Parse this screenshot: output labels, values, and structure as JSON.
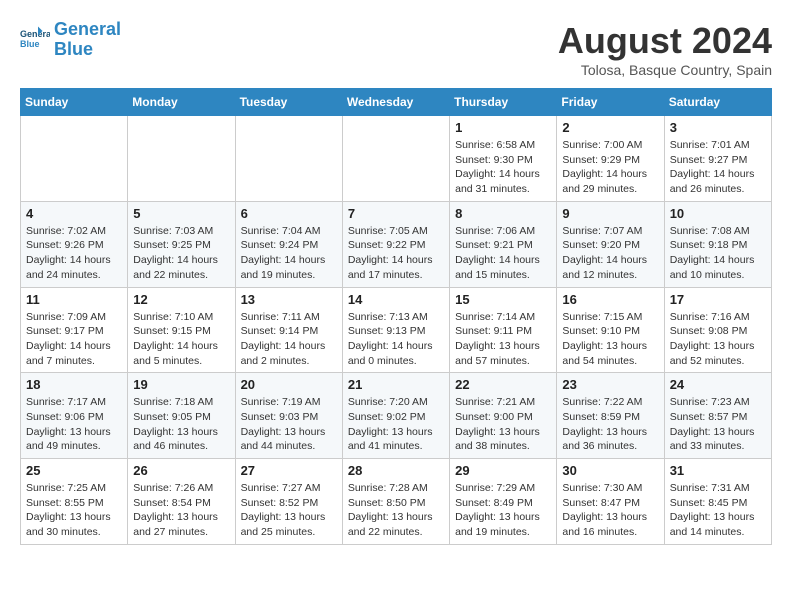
{
  "header": {
    "logo_line1": "General",
    "logo_line2": "Blue",
    "title": "August 2024",
    "subtitle": "Tolosa, Basque Country, Spain"
  },
  "weekdays": [
    "Sunday",
    "Monday",
    "Tuesday",
    "Wednesday",
    "Thursday",
    "Friday",
    "Saturday"
  ],
  "weeks": [
    [
      {
        "day": "",
        "info": ""
      },
      {
        "day": "",
        "info": ""
      },
      {
        "day": "",
        "info": ""
      },
      {
        "day": "",
        "info": ""
      },
      {
        "day": "1",
        "info": "Sunrise: 6:58 AM\nSunset: 9:30 PM\nDaylight: 14 hours\nand 31 minutes."
      },
      {
        "day": "2",
        "info": "Sunrise: 7:00 AM\nSunset: 9:29 PM\nDaylight: 14 hours\nand 29 minutes."
      },
      {
        "day": "3",
        "info": "Sunrise: 7:01 AM\nSunset: 9:27 PM\nDaylight: 14 hours\nand 26 minutes."
      }
    ],
    [
      {
        "day": "4",
        "info": "Sunrise: 7:02 AM\nSunset: 9:26 PM\nDaylight: 14 hours\nand 24 minutes."
      },
      {
        "day": "5",
        "info": "Sunrise: 7:03 AM\nSunset: 9:25 PM\nDaylight: 14 hours\nand 22 minutes."
      },
      {
        "day": "6",
        "info": "Sunrise: 7:04 AM\nSunset: 9:24 PM\nDaylight: 14 hours\nand 19 minutes."
      },
      {
        "day": "7",
        "info": "Sunrise: 7:05 AM\nSunset: 9:22 PM\nDaylight: 14 hours\nand 17 minutes."
      },
      {
        "day": "8",
        "info": "Sunrise: 7:06 AM\nSunset: 9:21 PM\nDaylight: 14 hours\nand 15 minutes."
      },
      {
        "day": "9",
        "info": "Sunrise: 7:07 AM\nSunset: 9:20 PM\nDaylight: 14 hours\nand 12 minutes."
      },
      {
        "day": "10",
        "info": "Sunrise: 7:08 AM\nSunset: 9:18 PM\nDaylight: 14 hours\nand 10 minutes."
      }
    ],
    [
      {
        "day": "11",
        "info": "Sunrise: 7:09 AM\nSunset: 9:17 PM\nDaylight: 14 hours\nand 7 minutes."
      },
      {
        "day": "12",
        "info": "Sunrise: 7:10 AM\nSunset: 9:15 PM\nDaylight: 14 hours\nand 5 minutes."
      },
      {
        "day": "13",
        "info": "Sunrise: 7:11 AM\nSunset: 9:14 PM\nDaylight: 14 hours\nand 2 minutes."
      },
      {
        "day": "14",
        "info": "Sunrise: 7:13 AM\nSunset: 9:13 PM\nDaylight: 14 hours\nand 0 minutes."
      },
      {
        "day": "15",
        "info": "Sunrise: 7:14 AM\nSunset: 9:11 PM\nDaylight: 13 hours\nand 57 minutes."
      },
      {
        "day": "16",
        "info": "Sunrise: 7:15 AM\nSunset: 9:10 PM\nDaylight: 13 hours\nand 54 minutes."
      },
      {
        "day": "17",
        "info": "Sunrise: 7:16 AM\nSunset: 9:08 PM\nDaylight: 13 hours\nand 52 minutes."
      }
    ],
    [
      {
        "day": "18",
        "info": "Sunrise: 7:17 AM\nSunset: 9:06 PM\nDaylight: 13 hours\nand 49 minutes."
      },
      {
        "day": "19",
        "info": "Sunrise: 7:18 AM\nSunset: 9:05 PM\nDaylight: 13 hours\nand 46 minutes."
      },
      {
        "day": "20",
        "info": "Sunrise: 7:19 AM\nSunset: 9:03 PM\nDaylight: 13 hours\nand 44 minutes."
      },
      {
        "day": "21",
        "info": "Sunrise: 7:20 AM\nSunset: 9:02 PM\nDaylight: 13 hours\nand 41 minutes."
      },
      {
        "day": "22",
        "info": "Sunrise: 7:21 AM\nSunset: 9:00 PM\nDaylight: 13 hours\nand 38 minutes."
      },
      {
        "day": "23",
        "info": "Sunrise: 7:22 AM\nSunset: 8:59 PM\nDaylight: 13 hours\nand 36 minutes."
      },
      {
        "day": "24",
        "info": "Sunrise: 7:23 AM\nSunset: 8:57 PM\nDaylight: 13 hours\nand 33 minutes."
      }
    ],
    [
      {
        "day": "25",
        "info": "Sunrise: 7:25 AM\nSunset: 8:55 PM\nDaylight: 13 hours\nand 30 minutes."
      },
      {
        "day": "26",
        "info": "Sunrise: 7:26 AM\nSunset: 8:54 PM\nDaylight: 13 hours\nand 27 minutes."
      },
      {
        "day": "27",
        "info": "Sunrise: 7:27 AM\nSunset: 8:52 PM\nDaylight: 13 hours\nand 25 minutes."
      },
      {
        "day": "28",
        "info": "Sunrise: 7:28 AM\nSunset: 8:50 PM\nDaylight: 13 hours\nand 22 minutes."
      },
      {
        "day": "29",
        "info": "Sunrise: 7:29 AM\nSunset: 8:49 PM\nDaylight: 13 hours\nand 19 minutes."
      },
      {
        "day": "30",
        "info": "Sunrise: 7:30 AM\nSunset: 8:47 PM\nDaylight: 13 hours\nand 16 minutes."
      },
      {
        "day": "31",
        "info": "Sunrise: 7:31 AM\nSunset: 8:45 PM\nDaylight: 13 hours\nand 14 minutes."
      }
    ]
  ]
}
